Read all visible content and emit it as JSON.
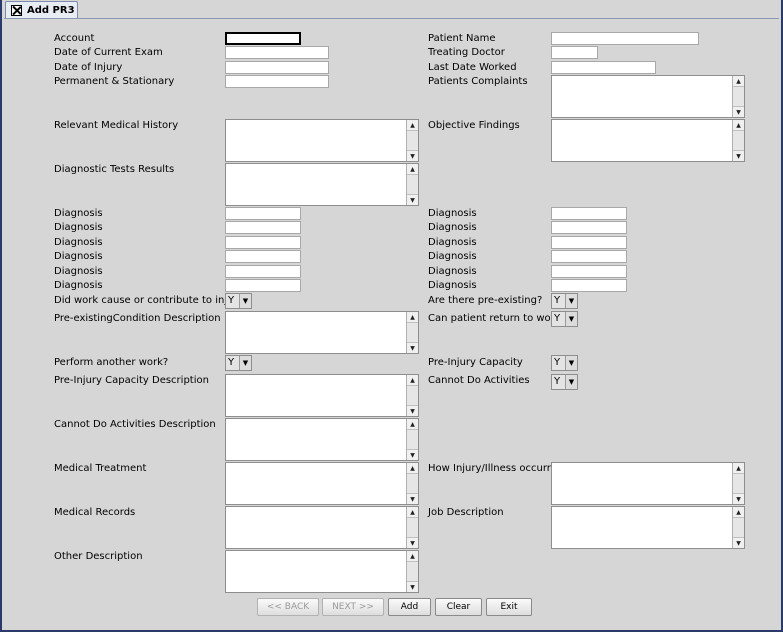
{
  "window": {
    "tab_title": "Add PR3"
  },
  "left_labels": {
    "account": "Account",
    "date_current_exam": "Date of Current Exam",
    "date_injury": "Date of Injury",
    "perm_stationary": "Permanent & Stationary",
    "relevant_history": "Relevant Medical History",
    "diag_tests": "Diagnostic Tests Results",
    "diagnosis": "Diagnosis",
    "work_cause": "Did work cause or contribute to injury?",
    "preexisting_desc": "Pre-existingCondition Description",
    "perform_another": "Perform another work?",
    "pre_injury_desc": "Pre-Injury Capacity Description",
    "cannot_do_desc": "Cannot Do Activities Description",
    "medical_treatment": "Medical Treatment",
    "medical_records": "Medical Records",
    "other_desc": "Other Description"
  },
  "right_labels": {
    "patient_name": "Patient Name",
    "treating_doctor": "Treating Doctor",
    "last_date_worked": "Last Date Worked",
    "patients_complaints": "Patients Complaints",
    "objective_findings": "Objective Findings",
    "diagnosis": "Diagnosis",
    "pre_existing": "Are there pre-existing?",
    "return_to_work": "Can patient return to work?",
    "pre_injury_capacity": "Pre-Injury Capacity",
    "cannot_do": "Cannot Do Activities",
    "how_injury": "How Injury/Illness occurred",
    "job_description": "Job Description"
  },
  "combos": {
    "work_cause": "Y",
    "pre_existing": "Y",
    "return_to_work": "Y",
    "perform_another": "Y",
    "pre_injury_capacity": "Y",
    "cannot_do": "Y"
  },
  "buttons": {
    "back": "<< BACK",
    "next": "NEXT >>",
    "add": "Add",
    "clear": "Clear",
    "exit": "Exit"
  },
  "icons": {
    "arrow_up": "scroll-up-icon",
    "arrow_down": "scroll-down-icon",
    "combo": "chevron-down-icon",
    "close": "close-icon"
  }
}
